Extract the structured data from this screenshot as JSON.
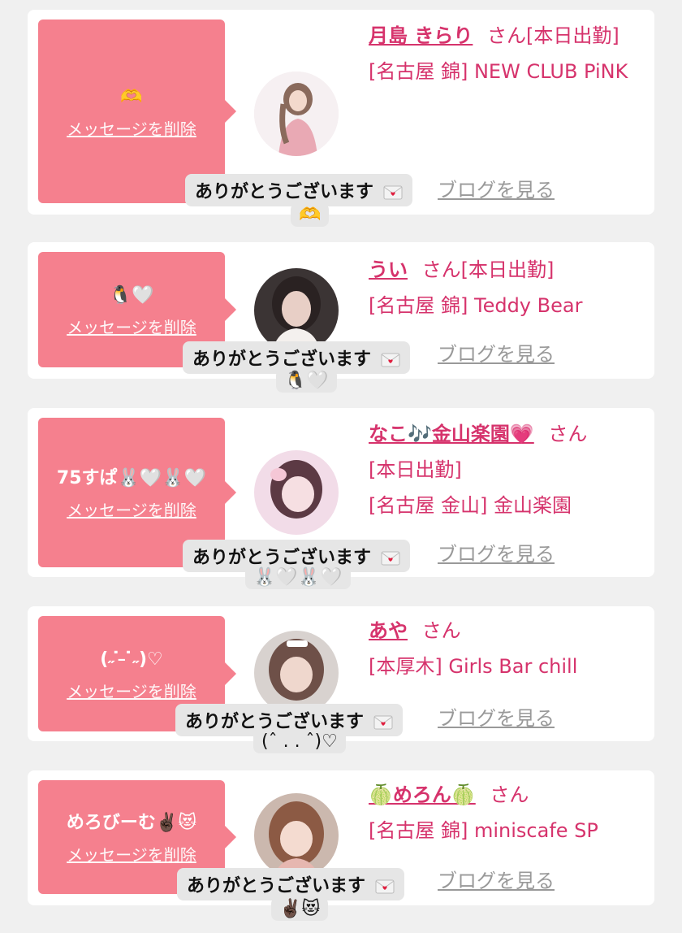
{
  "common": {
    "delete_label": "メッセージを削除",
    "blog_label": "ブログを見る",
    "honorific": "さん",
    "thanks_label": "ありがとうございます"
  },
  "cards": [
    {
      "message": "🫶",
      "name": "月島 きらり",
      "status": "[本日出勤]",
      "shop": "[名古屋 錦] NEW CLUB PiNK",
      "toast_sub": "🫶"
    },
    {
      "message": "🐧🤍",
      "name": "うい",
      "status": "[本日出勤]",
      "shop": "[名古屋 錦] Teddy Bear",
      "toast_sub": "🐧🤍"
    },
    {
      "message": "75すぱ🐰🤍🐰🤍",
      "name": "なこ🎶金山楽園💗",
      "status": "[本日出勤]",
      "shop": "[名古屋 金山] 金山楽園",
      "toast_sub": "🐰🤍🐰🤍"
    },
    {
      "message": "(˶ ̇ ̵ ̇˶)♡",
      "name": "あや",
      "status": "",
      "shop": "[本厚木] Girls Bar chill",
      "toast_sub": "(ˆ . . ˆ)♡"
    },
    {
      "message": "めろびーむ✌🏿😻",
      "name": "🍈めろん🍈",
      "status": "",
      "shop": "[名古屋 錦] miniscafe SP",
      "toast_sub": "✌🏿😻"
    }
  ]
}
